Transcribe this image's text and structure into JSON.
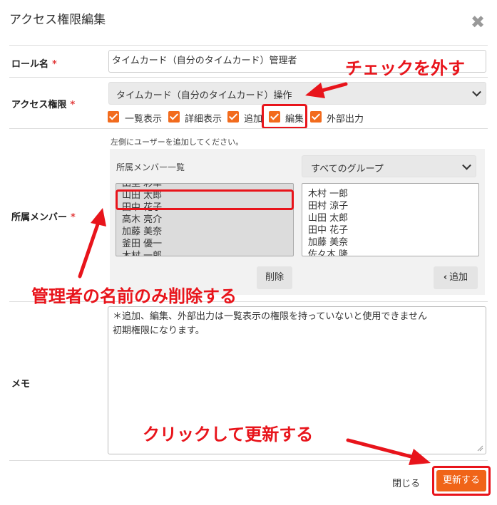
{
  "dialog": {
    "title": "アクセス権限編集",
    "close_symbol": "✖"
  },
  "role": {
    "label": "ロール名",
    "required_mark": "*",
    "value": "タイムカード（自分のタイムカード）管理者"
  },
  "access": {
    "label": "アクセス権限",
    "required_mark": "*",
    "select_value": "タイムカード（自分のタイムカード）操作",
    "checkboxes": [
      {
        "label": "一覧表示",
        "checked": true
      },
      {
        "label": "詳細表示",
        "checked": true
      },
      {
        "label": "追加",
        "checked": true
      },
      {
        "label": "編集",
        "checked": true
      },
      {
        "label": "外部出力",
        "checked": true
      }
    ]
  },
  "members": {
    "label": "所属メンバー",
    "required_mark": "*",
    "hint": "左側にユーザーを追加してください。",
    "list_title": "所属メンバー一覧",
    "group_select": "すべてのグループ",
    "left_list": [
      "田里 彩華",
      "山田 太郎",
      "田中 花子",
      "高木 亮介",
      "加藤 美奈",
      "釜田 優一",
      "木村 一郎"
    ],
    "right_list": [
      "木村 一郎",
      "田村 涼子",
      "山田 太郎",
      "田中 花子",
      "加藤 美奈",
      "佐々木 隆"
    ],
    "delete_button": "削除",
    "add_button": "追加",
    "add_symbol": "‹"
  },
  "memo": {
    "label": "メモ",
    "line1": "＊追加、編集、外部出力は一覧表示の権限を持っていないと使用できません",
    "line2": "初期権限になります。"
  },
  "footer": {
    "close_label": "閉じる",
    "update_label": "更新する"
  },
  "annotations": {
    "uncheck": "チェックを外す",
    "delete_admin": "管理者の名前のみ削除する",
    "click_update": "クリックして更新する"
  },
  "colors": {
    "accent": "#f26b1d",
    "annotation_red": "#e8141b"
  }
}
